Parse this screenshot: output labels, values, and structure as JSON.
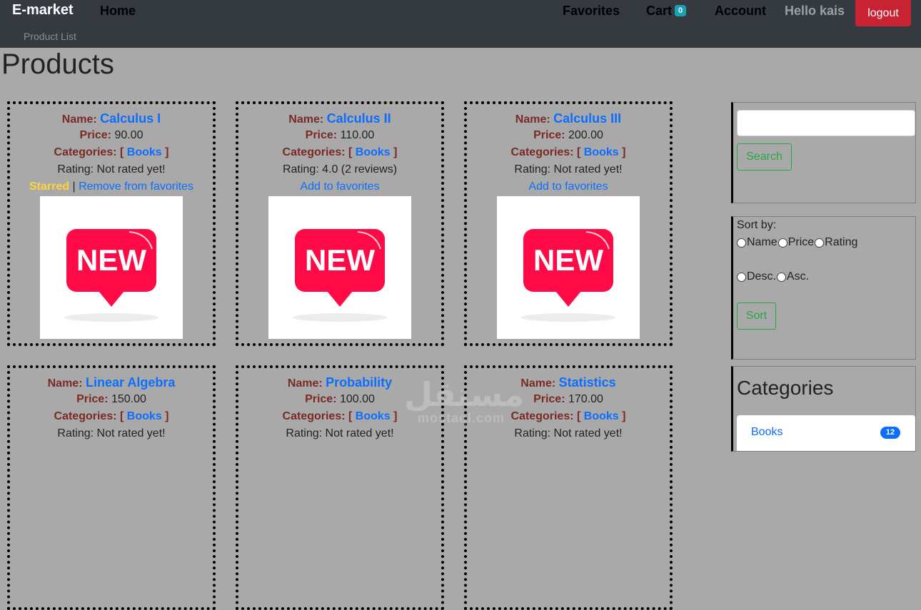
{
  "navbar": {
    "brand": "E-market",
    "home": "Home",
    "favorites": "Favorites",
    "cart": "Cart",
    "cart_count": "0",
    "account": "Account",
    "greeting": "Hello kais",
    "logout": "logout",
    "sub_link": "Product List"
  },
  "page": {
    "title": "Products"
  },
  "labels": {
    "name": "Name:",
    "price": "Price:",
    "categories": "Categories:",
    "bracket_open": "[",
    "bracket_close": "]",
    "starred": "Starred",
    "separator": "|",
    "remove_fav": "Remove from favorites",
    "add_fav": "Add to favorites"
  },
  "products": [
    {
      "name": "Calculus I",
      "price": "90.00",
      "category": "Books",
      "rating": "Rating: Not rated yet!",
      "starred": true
    },
    {
      "name": "Calculus II",
      "price": "110.00",
      "category": "Books",
      "rating": "Rating: 4.0 (2 reviews)",
      "starred": false
    },
    {
      "name": "Calculus III",
      "price": "200.00",
      "category": "Books",
      "rating": "Rating: Not rated yet!",
      "starred": false
    },
    {
      "name": "Linear Algebra",
      "price": "150.00",
      "category": "Books",
      "rating": "Rating: Not rated yet!"
    },
    {
      "name": "Probability",
      "price": "100.00",
      "category": "Books",
      "rating": "Rating: Not rated yet!"
    },
    {
      "name": "Statistics",
      "price": "170.00",
      "category": "Books",
      "rating": "Rating: Not rated yet!"
    }
  ],
  "product_image": {
    "text": "NEW",
    "color": "#ff0a47"
  },
  "sidebar": {
    "search": {
      "value": "",
      "placeholder": "",
      "button": "Search"
    },
    "sort": {
      "label": "Sort by:",
      "fields": [
        "Name",
        "Price",
        "Rating"
      ],
      "orders": [
        "Desc.",
        "Asc."
      ],
      "button": "Sort"
    },
    "categories": {
      "title": "Categories",
      "items": [
        {
          "label": "Books",
          "count": "12"
        }
      ]
    }
  },
  "watermark": {
    "arabic": "مستقل",
    "latin": "mostaql.com"
  },
  "colors": {
    "navbar": "#343a40",
    "background": "#a9a9a9",
    "link": "#0d6efd",
    "label": "#7a2a24",
    "starred": "#ffd43b",
    "danger": "#c82333",
    "success": "#28a745",
    "badge_info": "#17a2b8"
  }
}
